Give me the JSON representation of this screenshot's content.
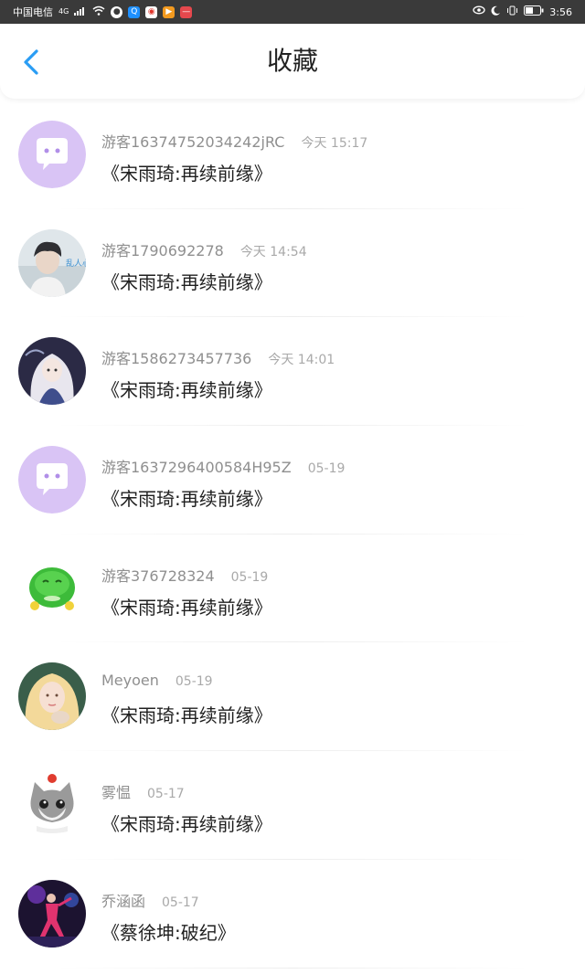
{
  "status_bar": {
    "carrier": "中国电信",
    "network": "4G",
    "time": "3:56",
    "battery": "",
    "apps": [
      "wechat-app-icon",
      "qq-browser-app-icon",
      "weibo-app-icon",
      "orange-app-icon",
      "red-app-icon"
    ]
  },
  "header": {
    "title": "收藏"
  },
  "items": [
    {
      "user": "游客16374752034242jRC",
      "time": "今天 15:17",
      "book": "《宋雨琦:再续前缘》",
      "avatar": "bubble"
    },
    {
      "user": "游客1790692278",
      "time": "今天 14:54",
      "book": "《宋雨琦:再续前缘》",
      "avatar": "photo-boy"
    },
    {
      "user": "游客1586273457736",
      "time": "今天 14:01",
      "book": "《宋雨琦:再续前缘》",
      "avatar": "anime-girl"
    },
    {
      "user": "游客1637296400584H95Z",
      "time": "05-19",
      "book": "《宋雨琦:再续前缘》",
      "avatar": "bubble"
    },
    {
      "user": "游客376728324",
      "time": "05-19",
      "book": "《宋雨琦:再续前缘》",
      "avatar": "green-blob"
    },
    {
      "user": "Meyoen",
      "time": "05-19",
      "book": "《宋雨琦:再续前缘》",
      "avatar": "blonde-girl"
    },
    {
      "user": "雾愠",
      "time": "05-17",
      "book": "《宋雨琦:再续前缘》",
      "avatar": "cat"
    },
    {
      "user": "乔涵函",
      "time": "05-17",
      "book": "《蔡徐坤:破纪》",
      "avatar": "dancer"
    }
  ],
  "colors": {
    "accent": "#2a9df4",
    "bubble_bg": "#d9c4f5"
  }
}
